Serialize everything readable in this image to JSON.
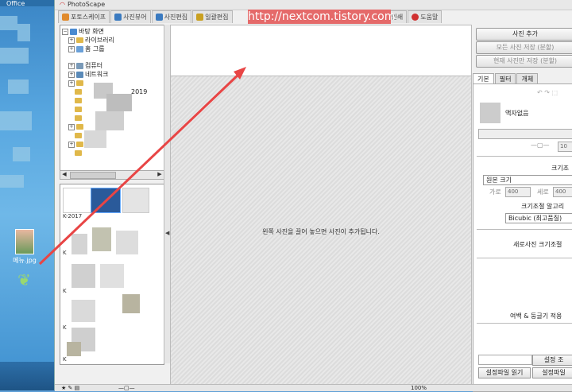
{
  "desktop": {
    "top_label": "Office",
    "file_icon_label": "메뉴.jpg"
  },
  "app": {
    "title": "PhotoScape",
    "watermark_url": "http://nextcom.tistory.com",
    "tabs": [
      {
        "label": "포토스케이프",
        "color": "#e08a2c"
      },
      {
        "label": "사진뷰어",
        "color": "#3a7ac0"
      },
      {
        "label": "사진편집",
        "color": "#3a7ac0"
      },
      {
        "label": "일괄편집",
        "color": "#c9a020"
      },
      {
        "label": "인쇄",
        "color": "#c9a020"
      },
      {
        "label": "도움말",
        "color": "#d03030"
      }
    ]
  },
  "tree": {
    "items": [
      "바탕 화면",
      "라이브러리",
      "홈 그룹",
      "컴퓨터",
      "네트워크"
    ],
    "partial_label": "2019"
  },
  "thumbnails": {
    "labels": [
      "K-2017",
      "K",
      "K",
      "K",
      "K"
    ]
  },
  "canvas": {
    "message": "왼쪽 사진을 끌어 놓으면 사진이 추가됩니다."
  },
  "right_panel": {
    "add_photo": "사진 추가",
    "save_all": "모든 사진 저장 (분할)",
    "save_current": "현재 사진만 저장 (분할)",
    "tabs": [
      "기본",
      "필터",
      "개체"
    ],
    "frame_none": "액자없음",
    "size_label": "크기조",
    "original_size": "원본 크기",
    "width_label": "가로",
    "width_value": "400",
    "height_label": "세로",
    "height_value": "400",
    "resize_algo_label": "크기조절 알고리",
    "bicubic": "Bicubic (최고품질)",
    "new_photo_size": "새로사진 크기조절",
    "margin_label": "여백 & 둥글기 적용",
    "settings_save": "설정 조",
    "settings_load": "설정파일 읽기",
    "settings_file": "설정파일",
    "slider_value": "10"
  },
  "status": {
    "zoom": "100%"
  }
}
